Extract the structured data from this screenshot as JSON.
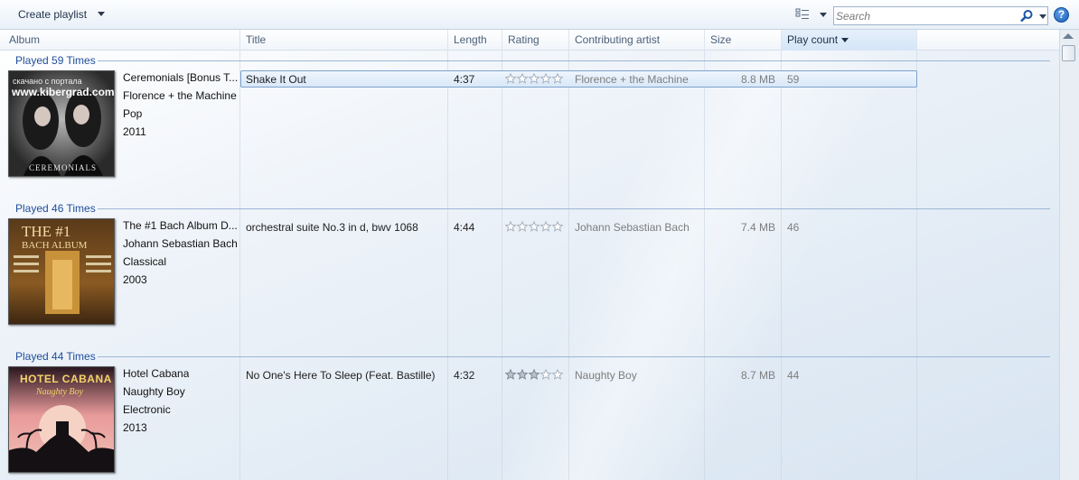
{
  "toolbar": {
    "create_playlist": "Create playlist",
    "search_placeholder": "Search",
    "help_glyph": "?"
  },
  "columns": {
    "album": "Album",
    "title": "Title",
    "length": "Length",
    "rating": "Rating",
    "artist": "Contributing artist",
    "size": "Size",
    "play_count": "Play count"
  },
  "groups": [
    {
      "header": "Played 59 Times",
      "album_title": "Ceremonials [Bonus T...",
      "album_artist": "Florence + the Machine",
      "genre": "Pop",
      "year": "2011",
      "cover_text": "скачано с портала",
      "cover_site": "www.kibergrad.com",
      "cover_caption": "CEREMONIALS",
      "track": {
        "title": "Shake It Out",
        "length": "4:37",
        "rating": 0,
        "artist": "Florence + the Machine",
        "size": "8.8 MB",
        "play_count": "59"
      }
    },
    {
      "header": "Played 46 Times",
      "album_title": "The #1 Bach Album D...",
      "album_artist": "Johann Sebastian Bach",
      "genre": "Classical",
      "year": "2003",
      "cover_text": "THE #1",
      "cover_site": "BACH ALBUM",
      "track": {
        "title": "orchestral suite No.3 in d, bwv 1068",
        "length": "4:44",
        "rating": 0,
        "artist": "Johann Sebastian Bach",
        "size": "7.4 MB",
        "play_count": "46"
      }
    },
    {
      "header": "Played 44 Times",
      "album_title": "Hotel Cabana",
      "album_artist": "Naughty Boy",
      "genre": "Electronic",
      "year": "2013",
      "cover_text": "HOTEL CABANA",
      "cover_site": "Naughty Boy",
      "track": {
        "title": "No One's Here To Sleep (Feat. Bastille)",
        "length": "4:32",
        "rating": 3,
        "artist": "Naughty Boy",
        "size": "8.7 MB",
        "play_count": "44"
      }
    }
  ]
}
